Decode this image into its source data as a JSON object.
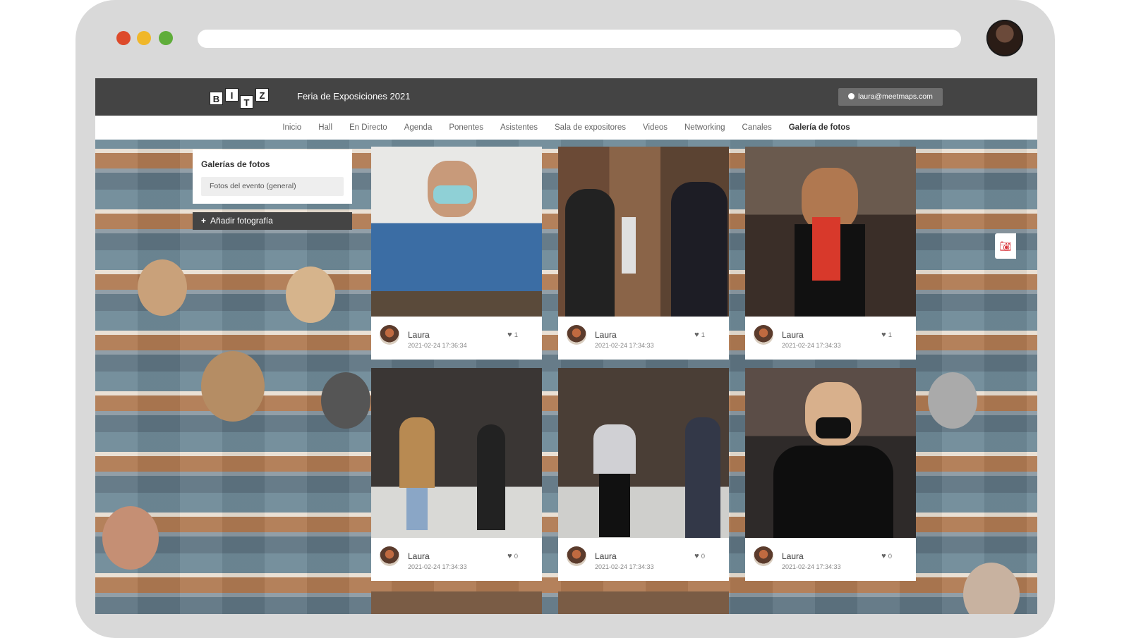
{
  "header": {
    "logo_letters": [
      "B",
      "I",
      "T",
      "Z"
    ],
    "event_title": "Feria de Exposiciones 2021",
    "user_email": "laura@meetmaps.com"
  },
  "nav": {
    "items": [
      {
        "label": "Inicio"
      },
      {
        "label": "Hall"
      },
      {
        "label": "En Directo"
      },
      {
        "label": "Agenda"
      },
      {
        "label": "Ponentes"
      },
      {
        "label": "Asistentes"
      },
      {
        "label": "Sala de expositores"
      },
      {
        "label": "Videos"
      },
      {
        "label": "Networking"
      },
      {
        "label": "Canales"
      },
      {
        "label": "Galería de fotos",
        "active": true
      }
    ]
  },
  "gallery_panel": {
    "title": "Galerías de fotos",
    "selected_gallery": "Fotos del evento (general)",
    "add_button": "Añadir fotografía"
  },
  "cards": [
    {
      "author": "Laura",
      "date": "2021-02-24 17:36:34",
      "likes": "1"
    },
    {
      "author": "Laura",
      "date": "2021-02-24 17:34:33",
      "likes": "1"
    },
    {
      "author": "Laura",
      "date": "2021-02-24 17:34:33",
      "likes": "1"
    },
    {
      "author": "Laura",
      "date": "2021-02-24 17:34:33",
      "likes": "0"
    },
    {
      "author": "Laura",
      "date": "2021-02-24 17:34:33",
      "likes": "0"
    },
    {
      "author": "Laura",
      "date": "2021-02-24 17:34:33",
      "likes": "0"
    }
  ],
  "icons": {
    "user": "user-circle-icon",
    "heart": "heart-icon",
    "camera": "camera-icon",
    "plus": "plus-icon"
  },
  "colors": {
    "topbar": "#444444",
    "camera_accent": "#d8333a",
    "window_red": "#dd4a2b",
    "window_yellow": "#f0b72a",
    "window_green": "#5fad3a"
  }
}
